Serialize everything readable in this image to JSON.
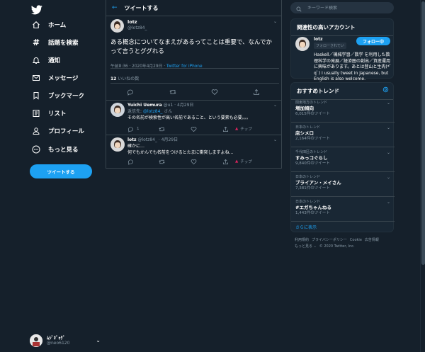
{
  "nav": {
    "items": [
      {
        "label": "ホーム",
        "icon": "home-icon"
      },
      {
        "label": "話題を検索",
        "icon": "hashtag-icon"
      },
      {
        "label": "通知",
        "icon": "bell-icon"
      },
      {
        "label": "メッセージ",
        "icon": "mail-icon"
      },
      {
        "label": "ブックマーク",
        "icon": "bookmark-icon"
      },
      {
        "label": "リスト",
        "icon": "list-icon"
      },
      {
        "label": "プロフィール",
        "icon": "person-icon"
      },
      {
        "label": "もっと見る",
        "icon": "more-icon"
      }
    ],
    "tweet_button": "ツイートする",
    "account": {
      "name": "ﾑｼﾞｷﾞｬｹﾞ",
      "handle": "@neo6120"
    }
  },
  "header": {
    "title": "ツイートする"
  },
  "main_tweet": {
    "name": "lotz",
    "handle": "@lotz84_",
    "text": "ある概念についてなまえがあるってことは重要で、なんでかって言うとググれる",
    "time": "午前8:36 · 2020年4月29日 · ",
    "source": "Twitter for iPhone",
    "likes_count": "12",
    "likes_label": " いいねの数"
  },
  "replies": [
    {
      "name": "Yuichi Uemura",
      "handle": "@u1",
      "date": " · 4月29日",
      "reply_to_prefix": "返信先: ",
      "reply_to_handle": "@lotz84_",
      "reply_to_suffix": "さん",
      "text": "その名前が検索性が高い名前であること、という要素も必要。。。",
      "reply_count": "1",
      "tip_label": "チップ"
    },
    {
      "name": "lotz",
      "handle": "@lotz84_",
      "date": " · 4月29日",
      "text1": "確かに…",
      "text2": "何でもかんでも名前をつけるとたまに衝突しますよね…",
      "tip_label": "チップ"
    }
  ],
  "search": {
    "placeholder": "キーワード検索"
  },
  "related": {
    "title": "関連性の高いアカウント",
    "name": "lotz",
    "follows_you": "フォローされてい",
    "follow_button": "フォロー中",
    "bio": "Haskell／機械学習／数学 を利用した数理科学の発展／経済圏の創出／資産運用 に興味があります。あとは登山と生肉(*ﾟqﾟ) I usually tweet in Japanese, but English is also welcome."
  },
  "trends": {
    "title": "おすすめトレンド",
    "items": [
      {
        "context": "関東地方のトレンド",
        "name": "増加傾向",
        "count": "6,015件のツイート"
      },
      {
        "context": "日本のトレンド",
        "name": "店シメロ",
        "count": "2,164件のツイート"
      },
      {
        "context": "千代田区のトレンド",
        "name": "すみっコぐらし",
        "count": "9,840件のツイート"
      },
      {
        "context": "日本のトレンド",
        "name": "ブライアン・メイさん",
        "count": "7,381件のツイート"
      },
      {
        "context": "日本のトレンド",
        "name": "#エガちゃんねる",
        "count": "1,443件のツイート"
      }
    ],
    "more": "さらに表示"
  },
  "footer": {
    "links": [
      "利用規約",
      "プライバシーポリシー",
      "Cookie",
      "広告情報"
    ],
    "more": "もっと見る ⌄",
    "copyright": "© 2020 Twitter, Inc."
  },
  "colors": {
    "background": "#15202b",
    "accent": "#1da1f2",
    "muted": "#8899a6",
    "card": "#192734"
  }
}
